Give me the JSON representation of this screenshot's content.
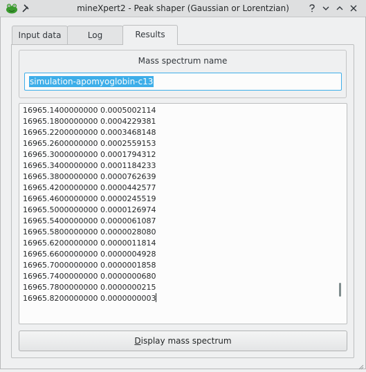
{
  "window": {
    "title": "mineXpert2 - Peak shaper (Gaussian or Lorentzian)",
    "icons": [
      "frog-app-icon",
      "pin-icon",
      "help-icon",
      "minimize-icon",
      "maximize-icon",
      "close-icon"
    ]
  },
  "tabs": [
    {
      "label": "Input data"
    },
    {
      "label": "Log"
    },
    {
      "label": "Results",
      "active": true
    }
  ],
  "results": {
    "group_title": "Mass spectrum name",
    "spectrum_name": "simulation-apomyoglobin-c13",
    "data_lines": [
      "16965.1400000000 0.0005002114",
      "16965.1800000000 0.0004229381",
      "16965.2200000000 0.0003468148",
      "16965.2600000000 0.0002559153",
      "16965.3000000000 0.0001794312",
      "16965.3400000000 0.0001184233",
      "16965.3800000000 0.0000762639",
      "16965.4200000000 0.0000442577",
      "16965.4600000000 0.0000245519",
      "16965.5000000000 0.0000126974",
      "16965.5400000000 0.0000061087",
      "16965.5800000000 0.0000028080",
      "16965.6200000000 0.0000011814",
      "16965.6600000000 0.0000004928",
      "16965.7000000000 0.0000001858",
      "16965.7400000000 0.0000000680",
      "16965.7800000000 0.0000000215",
      "16965.8200000000 0.0000000003"
    ],
    "display_button_mnemonic": "D",
    "display_button_rest": "isplay mass spectrum"
  },
  "colors": {
    "accent": "#3daee9",
    "window_bg": "#eff0f1"
  }
}
